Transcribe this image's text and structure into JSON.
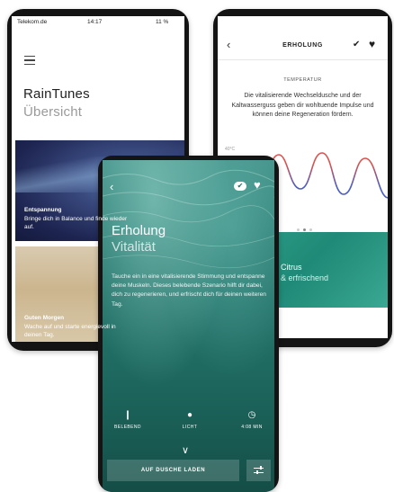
{
  "left_screen": {
    "status": {
      "carrier": "Telekom.de",
      "time": "14:17",
      "battery": "11 %"
    },
    "app_title": "RainTunes",
    "page_title": "Übersicht",
    "cards": [
      {
        "title": "Entspannung",
        "text": "Bringe dich in Balance und finde wieder auf."
      },
      {
        "title": "Guten Morgen",
        "text": "Wache auf und starte energievoll in deinen Tag."
      }
    ]
  },
  "right_screen": {
    "title": "ERHOLUNG",
    "section": "TEMPERATUR",
    "body": "Die vitalisierende Wechseldusche und der Kaltwasserguss geben dir wohltuende Impulse und können deine Regeneration fördern.",
    "temp_label": "40°C",
    "card": {
      "title": "Citrus",
      "subtitle": "& erfrischend"
    },
    "colors": {
      "warm": "#d9534f",
      "cold": "#4a5cc4",
      "accent": "#2ea28b"
    }
  },
  "center_screen": {
    "title": "Erholung",
    "subtitle": "Vitalität",
    "body": "Tauche ein in eine vitalisierende Stimmung und entspanne deine Muskeln. Dieses belebende Szenario hilft dir dabei, dich zu regenerieren, und erfrischt dich für deinen weiteren Tag.",
    "stats": [
      {
        "icon": "shower-icon",
        "label": "BELEBEND"
      },
      {
        "icon": "drop-icon",
        "label": "LICHT"
      },
      {
        "icon": "timer-icon",
        "label": "4:08 MIN"
      }
    ],
    "button": "AUF DUSCHE LADEN"
  }
}
